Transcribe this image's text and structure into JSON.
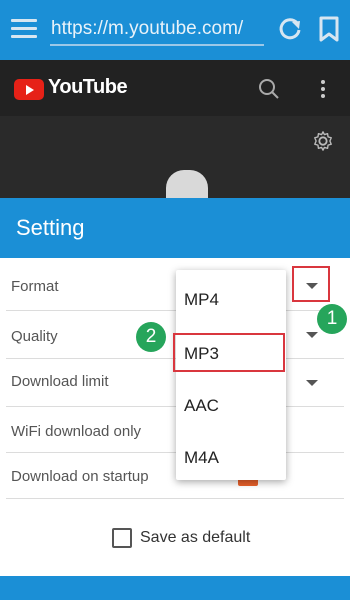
{
  "browser": {
    "url": "https://m.youtube.com/"
  },
  "youtube": {
    "logo_text": "YouTube"
  },
  "dialog": {
    "title": "Setting",
    "rows": [
      {
        "label": "Format"
      },
      {
        "label": "Quality"
      },
      {
        "label": "Download limit"
      },
      {
        "label": "WiFi download only"
      },
      {
        "label": "Download on startup"
      }
    ],
    "save_default_label": "Save as default"
  },
  "format_dropdown": {
    "options": [
      "MP4",
      "MP3",
      "AAC",
      "M4A"
    ],
    "highlighted_option": "MP3"
  },
  "annotations": {
    "step1": "1",
    "step2": "2",
    "badge_color": "#26a55b",
    "highlight_color": "#d9363e"
  },
  "colors": {
    "primary": "#1b8fd6",
    "dark_header": "#222222",
    "toggle_orange": "#e8602a"
  },
  "icons": {
    "menu": "hamburger-menu-icon",
    "refresh": "refresh-icon",
    "bookmark": "bookmark-icon",
    "search": "search-icon",
    "more": "more-vertical-icon",
    "settings": "gear-icon",
    "dropdown": "dropdown-arrow-icon",
    "checkbox": "checkbox-icon"
  }
}
